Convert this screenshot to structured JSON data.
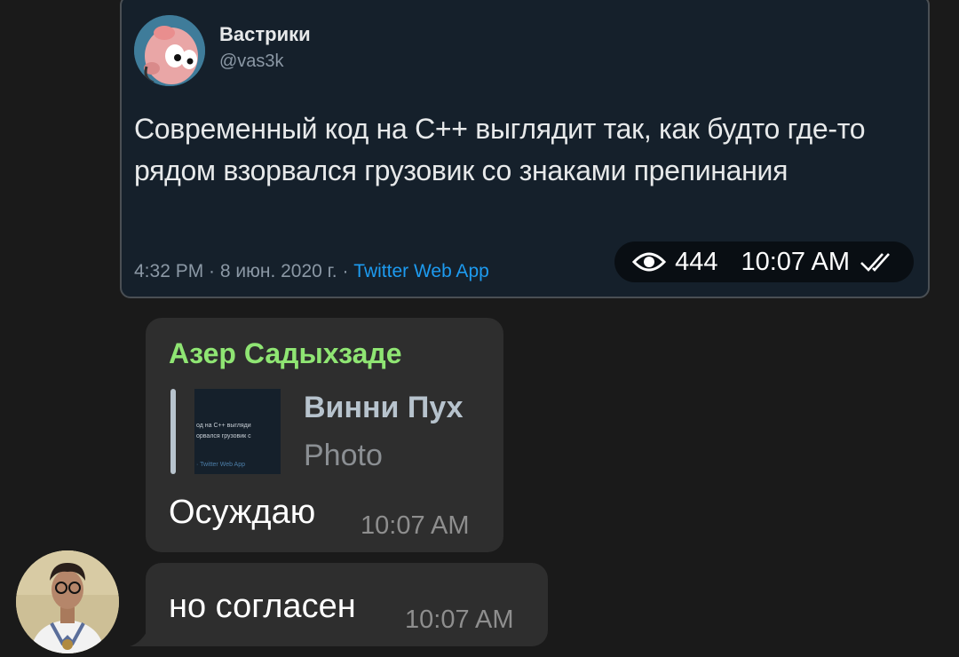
{
  "tweet": {
    "name": "Вастрики",
    "handle": "@vas3k",
    "text": "Современный код на С++ выглядит так, как будто где-то рядом взорвался грузовик со знаками препинания",
    "meta_date": "4:32 PM · 8 июн. 2020 г. · ",
    "meta_app": "Twitter Web App"
  },
  "image_info": {
    "views": "444",
    "time": "10:07 AM"
  },
  "message1": {
    "sender": "Азер Садыхзаде",
    "reply_name": "Винни Пух",
    "reply_type": "Photo",
    "thumb_line1": "од на С++ выгляди",
    "thumb_line2": "орвался грузовик с",
    "thumb_line3": "· Twitter Web App",
    "text": "Осуждаю",
    "time": "10:07 AM"
  },
  "message2": {
    "text": "но согласен",
    "time": "10:07 AM"
  },
  "colors": {
    "background": "#1a1a1a",
    "bubble": "#2e2e2e",
    "sender": "#8fe573",
    "tweet_bg": "#15202b",
    "link": "#1d9bf0"
  }
}
